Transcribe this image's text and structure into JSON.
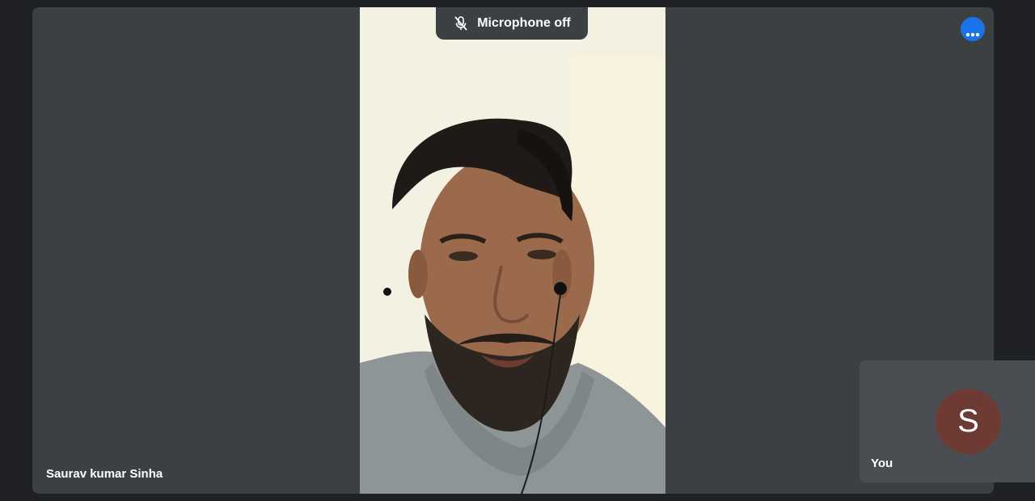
{
  "toast": {
    "text": "Microphone off",
    "icon": "microphone-off-icon"
  },
  "main_tile": {
    "participant_name": "Saurav kumar Sinha"
  },
  "more_options": {
    "icon": "more-horizontal-icon",
    "color": "#1a73e8"
  },
  "self_tile": {
    "label": "You",
    "avatar_initial": "S",
    "avatar_color": "#6d3b33"
  },
  "colors": {
    "background": "#202124",
    "tile": "#3c4043",
    "self_tile": "#4a4e52"
  }
}
